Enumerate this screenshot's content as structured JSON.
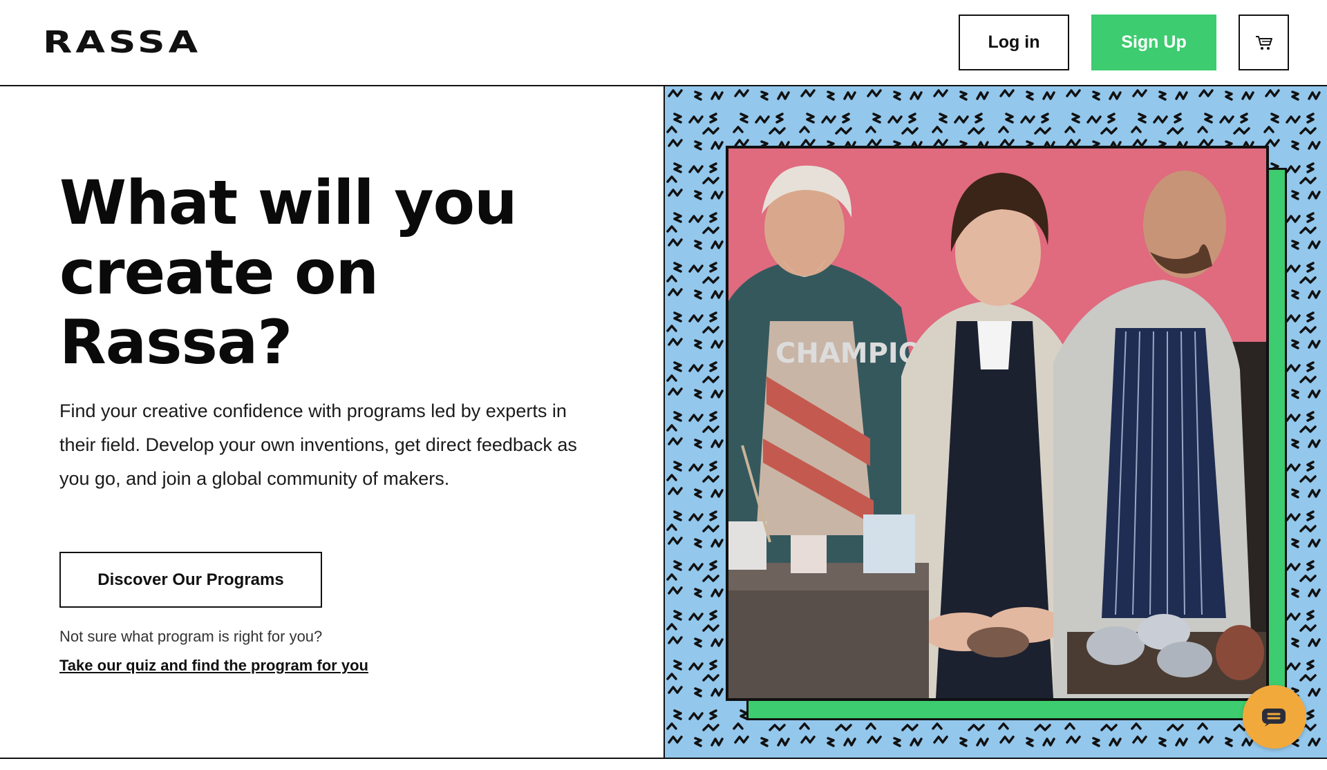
{
  "header": {
    "logo": "RASSA",
    "login_label": "Log in",
    "signup_label": "Sign Up",
    "cart_icon": "cart-icon",
    "signup_color": "#3dcc6f"
  },
  "hero": {
    "title_lines": [
      "What will you",
      "create on",
      "Rassa?"
    ],
    "description": "Find your creative confidence with programs led by experts in their field. Develop your own inventions, get direct feedback as you go, and join a global community of makers.",
    "discover_label": "Discover Our Programs",
    "quiz_hint": "Not sure what program is right for you?",
    "quiz_link": "Take our quiz and find the program for you"
  },
  "hero_image": {
    "shirt_text": "CHAMPION",
    "background_color": "#93c7ec",
    "frame_color": "#3dcc6f",
    "photo_bg_color": "#e06a7e"
  },
  "chat": {
    "icon": "chat-icon",
    "color": "#f2a93b"
  }
}
